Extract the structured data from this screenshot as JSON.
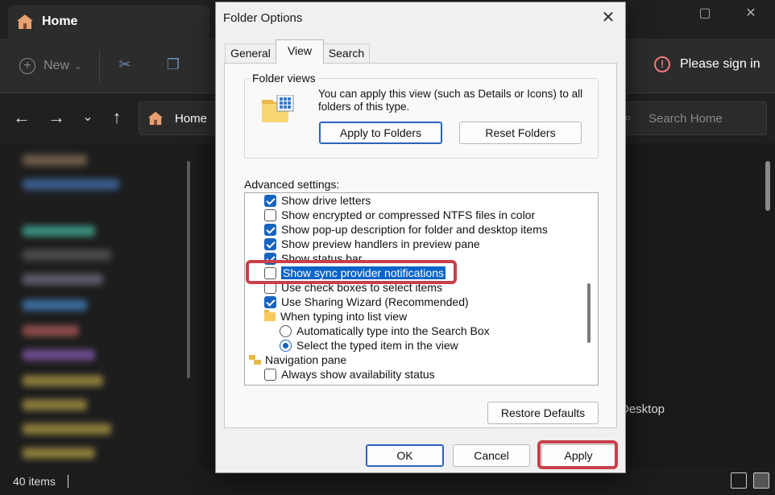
{
  "explorer": {
    "tab_title": "Home",
    "new_label": "New",
    "sign_in": "Please sign in",
    "address": "Home",
    "search_placeholder": "Search Home",
    "desktop_label": "Desktop",
    "status_count": "40 items"
  },
  "dialog": {
    "title": "Folder Options",
    "tabs": [
      {
        "label": "General"
      },
      {
        "label": "View"
      },
      {
        "label": "Search"
      }
    ],
    "active_tab": "View",
    "folder_views": {
      "label": "Folder views",
      "description": "You can apply this view (such as Details or Icons) to all folders of this type.",
      "apply_button": "Apply to Folders",
      "reset_button": "Reset Folders"
    },
    "advanced_label": "Advanced settings:",
    "advanced_items": [
      {
        "type": "checkbox",
        "checked": true,
        "label": "Show drive letters"
      },
      {
        "type": "checkbox",
        "checked": false,
        "label": "Show encrypted or compressed NTFS files in color"
      },
      {
        "type": "checkbox",
        "checked": true,
        "label": "Show pop-up description for folder and desktop items"
      },
      {
        "type": "checkbox",
        "checked": true,
        "label": "Show preview handlers in preview pane"
      },
      {
        "type": "checkbox",
        "checked": true,
        "label": "Show status bar"
      },
      {
        "type": "checkbox",
        "checked": false,
        "label": "Show sync provider notifications",
        "selected": true
      },
      {
        "type": "checkbox",
        "checked": false,
        "label": "Use check boxes to select items"
      },
      {
        "type": "checkbox",
        "checked": true,
        "label": "Use Sharing Wizard (Recommended)"
      },
      {
        "type": "folder",
        "label": "When typing into list view"
      },
      {
        "type": "radio",
        "checked": false,
        "label": "Automatically type into the Search Box"
      },
      {
        "type": "radio",
        "checked": true,
        "label": "Select the typed item in the view"
      },
      {
        "type": "navfolder",
        "label": "Navigation pane"
      },
      {
        "type": "checkbox",
        "checked": false,
        "label": "Always show availability status"
      }
    ],
    "restore_defaults": "Restore Defaults",
    "ok": "OK",
    "cancel": "Cancel",
    "apply": "Apply"
  },
  "colors": {
    "accent": "#1764c0",
    "highlight_border": "#c8404a",
    "selection": "#0a64c8"
  }
}
